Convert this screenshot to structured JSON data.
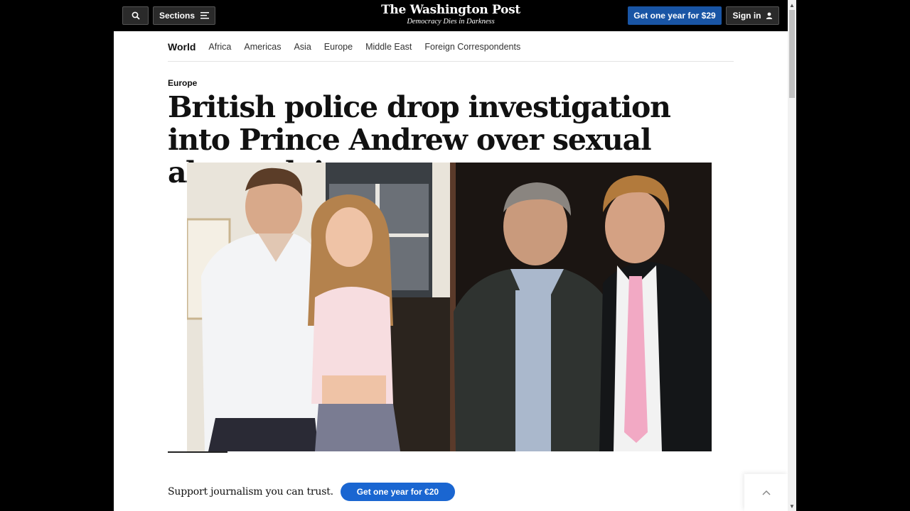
{
  "header": {
    "search_icon": "search-icon",
    "sections_label": "Sections",
    "menu_icon": "hamburger-menu-icon",
    "logo_title": "The Washington Post",
    "logo_tagline": "Democracy Dies in Darkness",
    "subscribe_label": "Get one year for $29",
    "signin_label": "Sign in",
    "user_icon": "user-icon"
  },
  "subnav": {
    "section": "World",
    "links": [
      "Africa",
      "Americas",
      "Asia",
      "Europe",
      "Middle East",
      "Foreign Correspondents"
    ]
  },
  "article": {
    "kicker": "Europe",
    "headline": "British police drop investigation into Prince Andrew over sexual abuse claims"
  },
  "support": {
    "text": "Support journalism you can trust.",
    "button_label": "Get one year for €20"
  },
  "colors": {
    "subscribe_blue": "#1955a5",
    "support_blue": "#1a66d1",
    "header_black": "#000000"
  }
}
